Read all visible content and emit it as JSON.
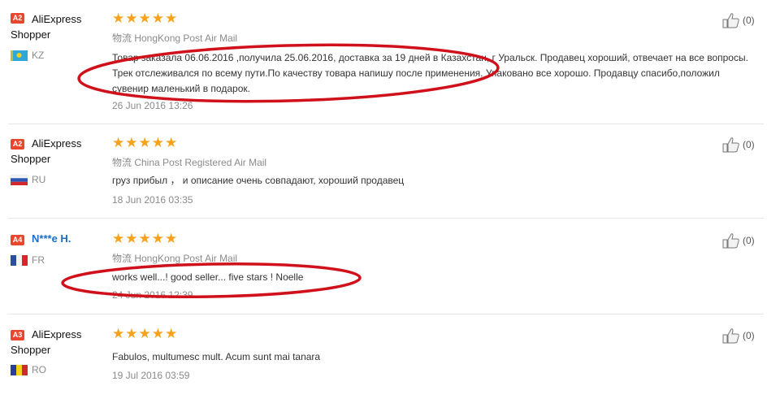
{
  "reviews": [
    {
      "badge": "A2",
      "buyer": "AliExpress Shopper",
      "country": "KZ",
      "rating": 5,
      "stars": "★★★★★",
      "logistics": "物流 HongKong Post Air Mail",
      "feedback": "Товар заказала 06.06.2016 ,получила 25.06.2016, доставка за 19 дней в Казахстан, г Уральск. Продавец хороший, отвечает на все вопросы. Трек отслеживался по всему пути.По качеству товара напишу после применения. Упаковано все хорошо. Продавцу спасибо,положил сувенир маленький в подарок.",
      "date": "26 Jun 2016 13:26",
      "helpful": "(0)"
    },
    {
      "badge": "A2",
      "buyer": "AliExpress Shopper",
      "country": "RU",
      "rating": 5,
      "stars": "★★★★★",
      "logistics": "物流 China Post Registered Air Mail",
      "feedback": "груз прибыл ， и описание  очень  совпадают,  хороший  продавец",
      "date": "18 Jun 2016 03:35",
      "helpful": "(0)"
    },
    {
      "badge": "A4",
      "buyer": "N***e H.",
      "country": "FR",
      "rating": 5,
      "stars": "★★★★★",
      "logistics": "物流 HongKong Post Air Mail",
      "feedback": "works well...! good seller... five stars ! Noelle",
      "date": "24 Jun 2016 12:39",
      "helpful": "(0)"
    },
    {
      "badge": "A3",
      "buyer": "AliExpress Shopper",
      "country": "RO",
      "rating": 5,
      "stars": "★★★★★",
      "logistics": "",
      "feedback": "Fabulos, multumesc mult. Acum sunt mai tanara",
      "date": "19 Jul 2016 03:59",
      "helpful": "(0)"
    }
  ],
  "colors": {
    "star": "#f7a21b",
    "badge": "#e8462f",
    "annotation": "#d0101a",
    "link": "#1a6fc4"
  },
  "icons": [
    "thumbs-up-icon",
    "flag-icon",
    "star-icon"
  ]
}
